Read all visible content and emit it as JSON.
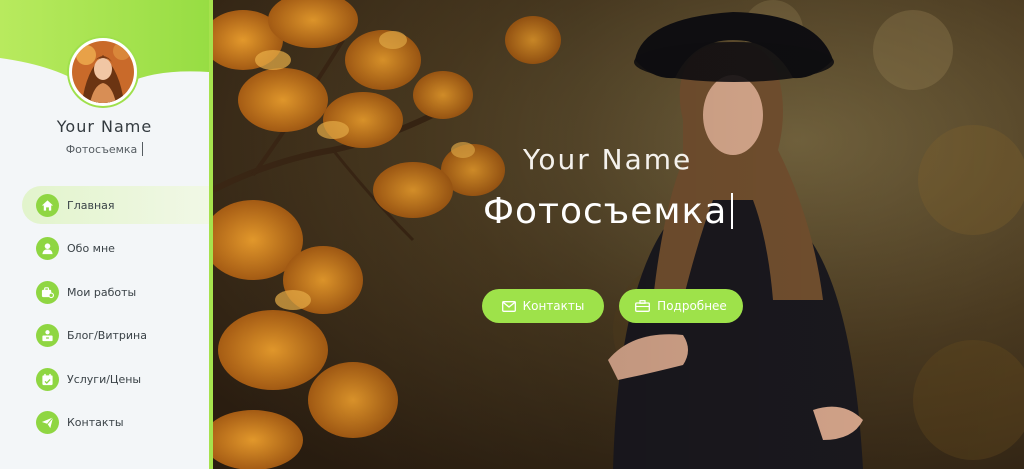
{
  "colors": {
    "accent": "#9ee24a",
    "sidebar_bg": "#f3f6f8",
    "text_dark": "#333a3f"
  },
  "profile": {
    "name": "Your Name",
    "role": "Фотосъемка"
  },
  "nav": {
    "items": [
      {
        "label": "Главная",
        "icon": "home-icon",
        "active": true
      },
      {
        "label": "Обо мне",
        "icon": "user-icon",
        "active": false
      },
      {
        "label": "Мои работы",
        "icon": "works-icon",
        "active": false
      },
      {
        "label": "Блог/Витрина",
        "icon": "blog-icon",
        "active": false
      },
      {
        "label": "Услуги/Цены",
        "icon": "calendar-icon",
        "active": false
      },
      {
        "label": "Контакты",
        "icon": "send-icon",
        "active": false
      }
    ]
  },
  "hero": {
    "name": "Your Name",
    "role": "Фотосъемка",
    "buttons": {
      "contacts": "Контакты",
      "more": "Подробнее"
    }
  }
}
